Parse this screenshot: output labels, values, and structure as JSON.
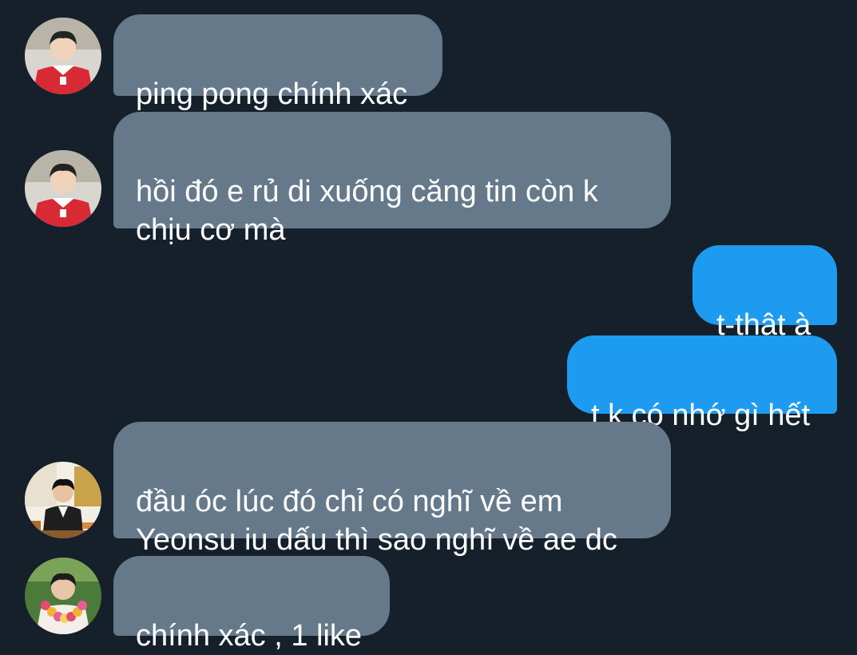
{
  "conversation": {
    "messages": [
      {
        "direction": "incoming",
        "sender_avatar": "avatar-red-jersey",
        "text": "ping pong chính xác"
      },
      {
        "direction": "incoming",
        "sender_avatar": "avatar-red-jersey",
        "text": "hồi đó e rủ di xuống căng tin còn k\nchịu cơ mà"
      },
      {
        "direction": "outgoing",
        "text": "t-thật à"
      },
      {
        "direction": "outgoing",
        "text": "t k có nhớ gì hết"
      },
      {
        "direction": "incoming",
        "sender_avatar": "avatar-cafe",
        "text": "đầu óc lúc đó chỉ có nghĩ về em\nYeonsu iu dấu thì sao nghĩ về ae dc"
      },
      {
        "direction": "incoming",
        "sender_avatar": "avatar-flower-garland",
        "text": "chính xác , 1 like"
      }
    ]
  },
  "colors": {
    "background": "#15202b",
    "incoming_bubble": "#66798a",
    "outgoing_bubble": "#1d9bf0",
    "text": "#ffffff"
  }
}
